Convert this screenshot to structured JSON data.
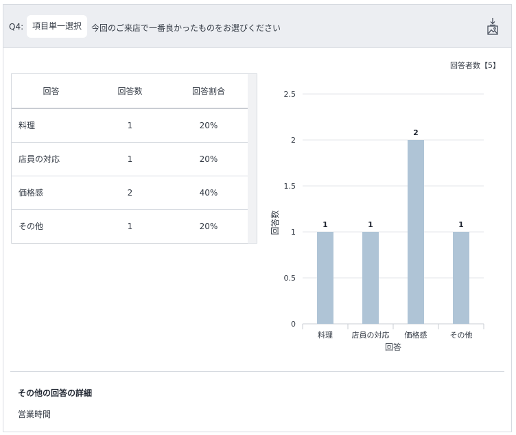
{
  "question": {
    "number": "Q4:",
    "type_label": "項目単一選択",
    "text": "今回のご来店で一番良かったものをお選びください"
  },
  "respondents_label": "回答者数【5】",
  "table": {
    "headers": [
      "回答",
      "回答数",
      "回答割合"
    ],
    "rows": [
      {
        "answer": "料理",
        "count": "1",
        "ratio": "20%"
      },
      {
        "answer": "店員の対応",
        "count": "1",
        "ratio": "20%"
      },
      {
        "answer": "価格感",
        "count": "2",
        "ratio": "40%"
      },
      {
        "answer": "その他",
        "count": "1",
        "ratio": "20%"
      }
    ]
  },
  "chart_data": {
    "type": "bar",
    "categories": [
      "料理",
      "店員の対応",
      "価格感",
      "その他"
    ],
    "values": [
      1,
      1,
      2,
      1
    ],
    "data_labels": [
      "1",
      "1",
      "2",
      "1"
    ],
    "xlabel": "回答",
    "ylabel": "回答数",
    "ylim": [
      0,
      2.5
    ],
    "yticks": [
      0,
      0.5,
      1,
      1.5,
      2,
      2.5
    ],
    "ytick_labels": [
      "0",
      "0.5",
      "1",
      "1.5",
      "2",
      "2.5"
    ],
    "grid": true,
    "bar_color": "#afc4d6"
  },
  "other_answers": {
    "title": "その他の回答の詳細",
    "items": [
      "営業時間"
    ]
  },
  "icons": {
    "download": "image-download-icon"
  }
}
